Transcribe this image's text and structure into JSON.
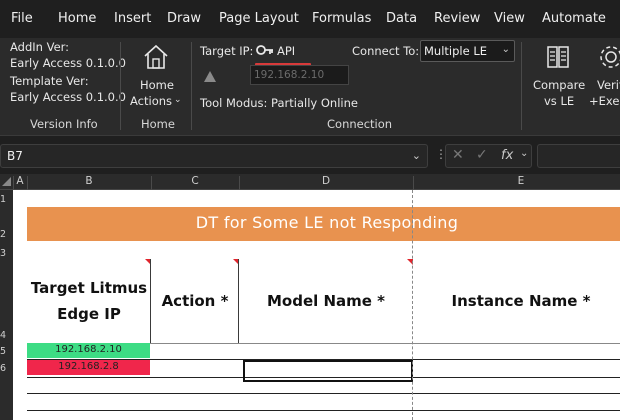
{
  "menu": [
    "File",
    "Home",
    "Insert",
    "Draw",
    "Page Layout",
    "Formulas",
    "Data",
    "Review",
    "View",
    "Automate"
  ],
  "ribbon": {
    "version_info": {
      "addin_label": "AddIn Ver:",
      "addin_value": "Early Access 0.1.0.0",
      "template_label": "Template Ver:",
      "template_value": "Early Access 0.1.0.0",
      "group_label": "Version Info"
    },
    "home": {
      "button_line1": "Home",
      "button_line2": "Actions",
      "group_label": "Home"
    },
    "connection": {
      "target_ip_label": "Target IP:",
      "api_label": "API",
      "ip_placeholder": "192.168.2.10",
      "tool_modus": "Tool Modus: Partially Online",
      "connect_to_label": "Connect To:",
      "connect_to_value": "Multiple LE",
      "group_label": "Connection"
    },
    "compare": {
      "line1": "Compare",
      "line2": "vs LE"
    },
    "verify": {
      "line1": "Verif",
      "line2": "+Exec"
    }
  },
  "formula_bar": {
    "name_box": "B7",
    "fx_label": "fx"
  },
  "columns": [
    "A",
    "B",
    "C",
    "D",
    "E"
  ],
  "rows": [
    "1",
    "2",
    "3",
    "4",
    "5",
    "6"
  ],
  "sheet": {
    "banner": "DT for Some LE not Responding",
    "headers": {
      "target": "Target Litmus Edge IP",
      "action": "Action *",
      "model": "Model Name *",
      "instance": "Instance Name *"
    },
    "ip_rows": [
      {
        "ip": "192.168.2.10",
        "color": "#3ddc84"
      },
      {
        "ip": "192.168.2.8",
        "color": "#f0264b"
      }
    ]
  },
  "colors": {
    "banner": "#e8924f",
    "ribbon_bg": "#2b2b2b",
    "accent_red": "#d83a3a"
  }
}
